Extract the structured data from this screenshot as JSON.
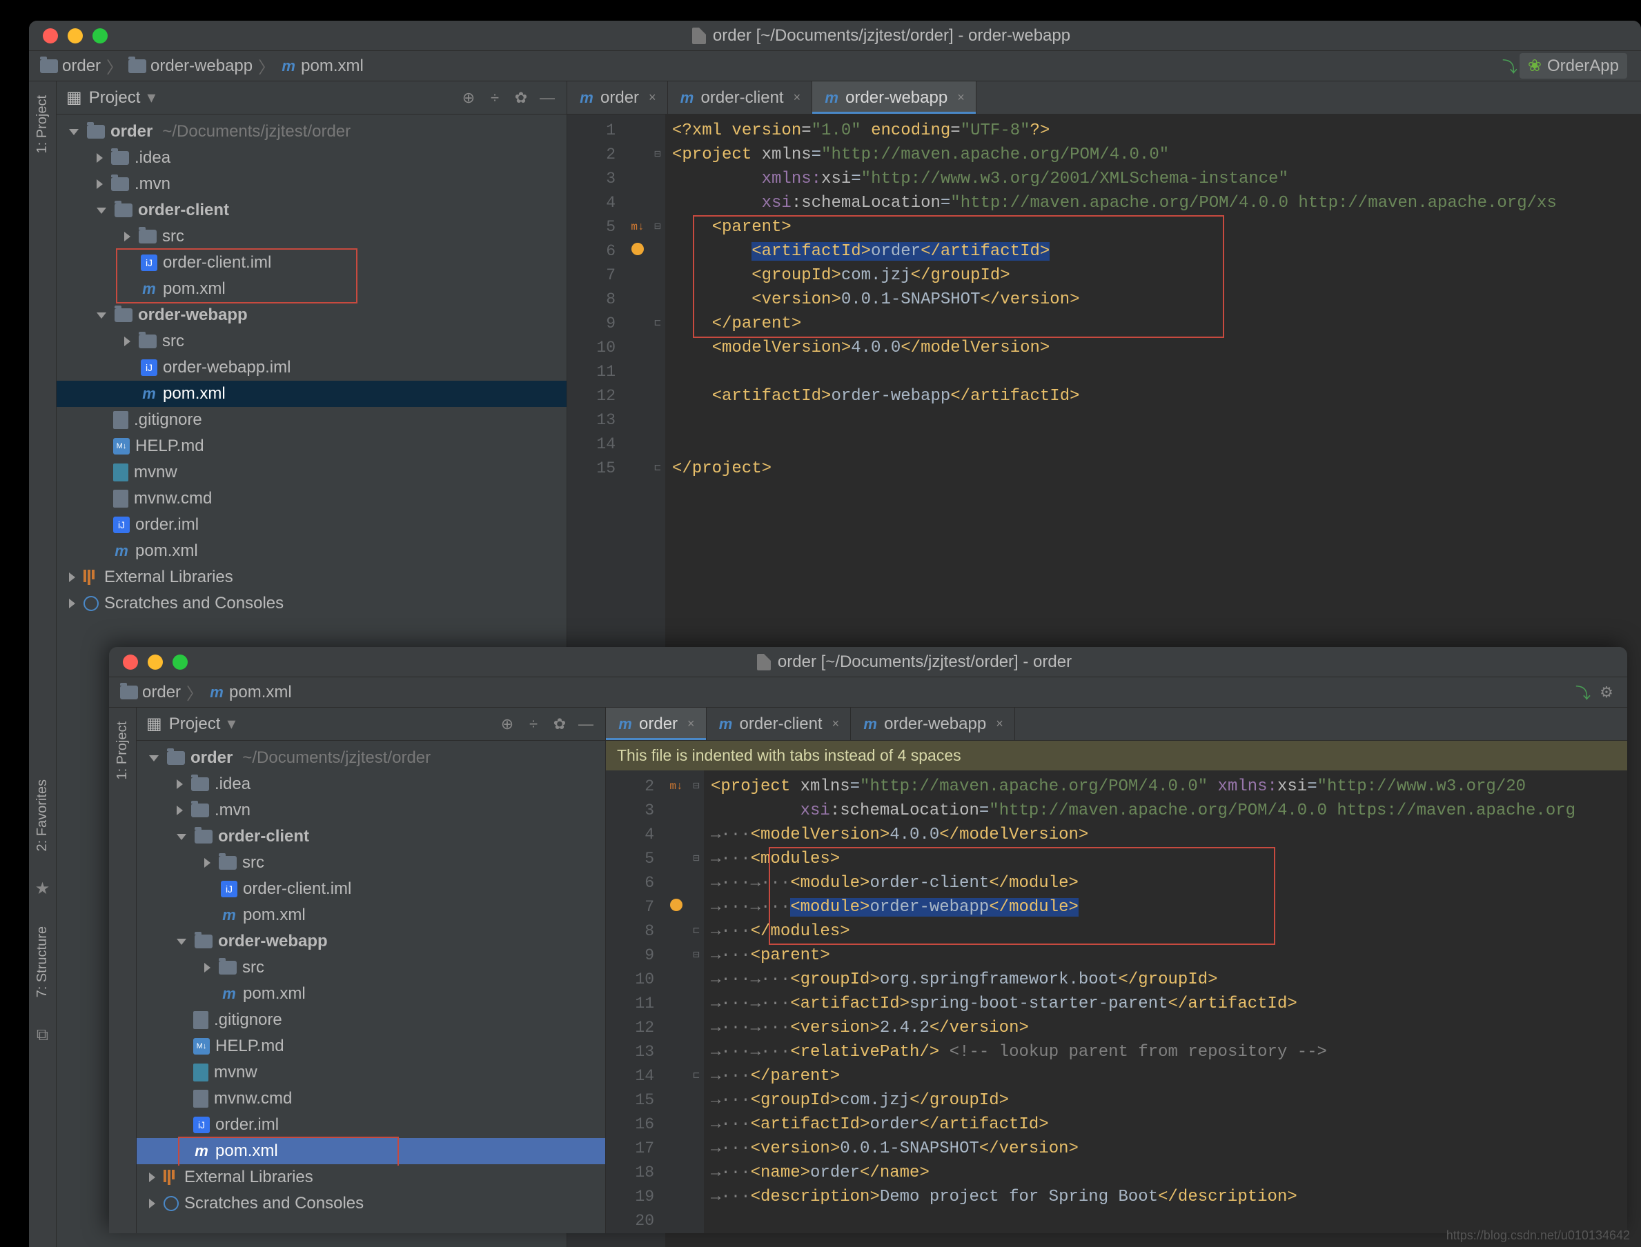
{
  "watermark": "https://blog.csdn.net/u010134642",
  "window1": {
    "title": "order [~/Documents/jzjtest/order] - order-webapp",
    "breadcrumbs": [
      "order",
      "order-webapp",
      "pom.xml"
    ],
    "run_config": "OrderApp",
    "sidebar": {
      "header": "Project",
      "tree": {
        "root": {
          "name": "order",
          "path": "~/Documents/jzjtest/order"
        },
        "idea": ".idea",
        "mvn": ".mvn",
        "order_client": "order-client",
        "oc_src": "src",
        "oc_iml": "order-client.iml",
        "oc_pom": "pom.xml",
        "order_webapp": "order-webapp",
        "ow_src": "src",
        "ow_iml": "order-webapp.iml",
        "ow_pom": "pom.xml",
        "gitignore": ".gitignore",
        "help": "HELP.md",
        "mvnw": "mvnw",
        "mvnwcmd": "mvnw.cmd",
        "orderiml": "order.iml",
        "pom": "pom.xml",
        "extlib": "External Libraries",
        "scratch": "Scratches and Consoles"
      }
    },
    "tabs": [
      "order",
      "order-client",
      "order-webapp"
    ],
    "code": {
      "l1": "<?xml version=\"1.0\" encoding=\"UTF-8\"?>",
      "l2": "<project xmlns=\"http://maven.apache.org/POM/4.0.0\"",
      "l3": "         xmlns:xsi=\"http://www.w3.org/2001/XMLSchema-instance\"",
      "l4": "         xsi:schemaLocation=\"http://maven.apache.org/POM/4.0.0 http://maven.apache.org/xs",
      "l5": "    <parent>",
      "l6": "        <artifactId>order</artifactId>",
      "l7": "        <groupId>com.jzj</groupId>",
      "l8": "        <version>0.0.1-SNAPSHOT</version>",
      "l9": "    </parent>",
      "l10": "    <modelVersion>4.0.0</modelVersion>",
      "l11": "",
      "l12": "    <artifactId>order-webapp</artifactId>",
      "l13": "",
      "l14": "",
      "l15": "</project>"
    }
  },
  "window2": {
    "title": "order [~/Documents/jzjtest/order] - order",
    "breadcrumbs": [
      "order",
      "pom.xml"
    ],
    "sidebar": {
      "header": "Project",
      "tree": {
        "root": {
          "name": "order",
          "path": "~/Documents/jzjtest/order"
        },
        "idea": ".idea",
        "mvn": ".mvn",
        "order_client": "order-client",
        "oc_src": "src",
        "oc_iml": "order-client.iml",
        "oc_pom": "pom.xml",
        "order_webapp": "order-webapp",
        "ow_src": "src",
        "ow_pom": "pom.xml",
        "gitignore": ".gitignore",
        "help": "HELP.md",
        "mvnw": "mvnw",
        "mvnwcmd": "mvnw.cmd",
        "orderiml": "order.iml",
        "pom": "pom.xml",
        "extlib": "External Libraries",
        "scratch": "Scratches and Consoles"
      }
    },
    "tabs": [
      "order",
      "order-client",
      "order-webapp"
    ],
    "banner": "This file is indented with tabs instead of 4 spaces",
    "code": {
      "l2": "<project xmlns=\"http://maven.apache.org/POM/4.0.0\" xmlns:xsi=\"http://www.w3.org/20",
      "l3": "         xsi:schemaLocation=\"http://maven.apache.org/POM/4.0.0 https://maven.apache.org",
      "l4": "    <modelVersion>4.0.0</modelVersion>",
      "l5": "    <modules>",
      "l6": "        <module>order-client</module>",
      "l7": "        <module>order-webapp</module>",
      "l8": "    </modules>",
      "l9": "    <parent>",
      "l10": "        <groupId>org.springframework.boot</groupId>",
      "l11": "        <artifactId>spring-boot-starter-parent</artifactId>",
      "l12": "        <version>2.4.2</version>",
      "l13": "        <relativePath/> <!-- lookup parent from repository -->",
      "l14": "    </parent>",
      "l15": "    <groupId>com.jzj</groupId>",
      "l16": "    <artifactId>order</artifactId>",
      "l17": "    <version>0.0.1-SNAPSHOT</version>",
      "l18": "    <name>order</name>",
      "l19": "    <description>Demo project for Spring Boot</description>",
      "l20": ""
    }
  },
  "rails": {
    "project": "1: Project",
    "favorites": "2: Favorites",
    "structure": "7: Structure"
  }
}
